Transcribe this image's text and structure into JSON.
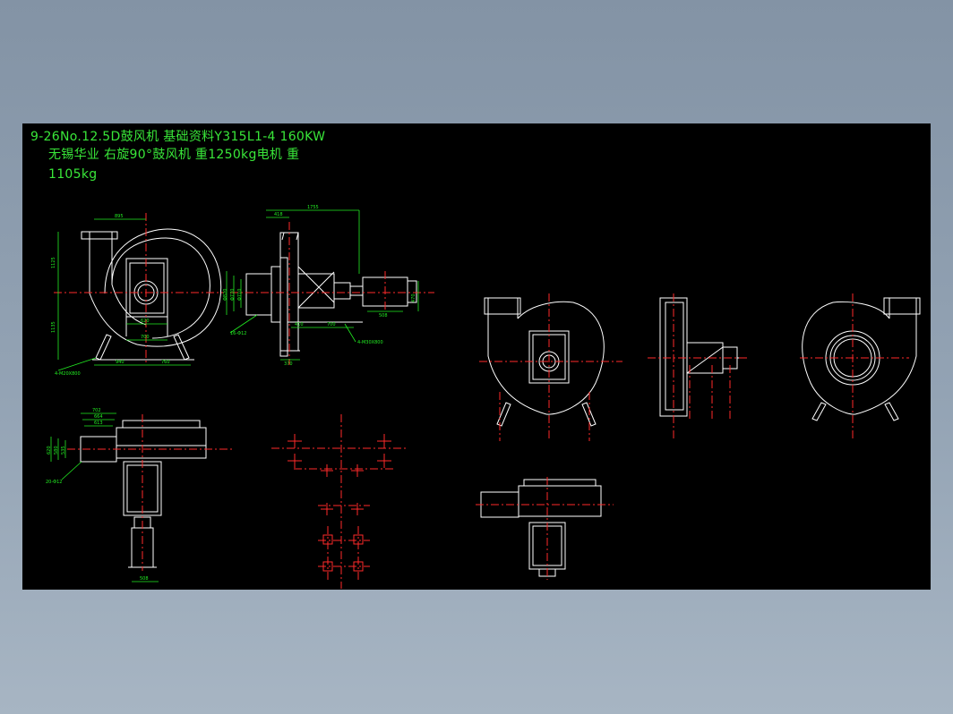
{
  "title": {
    "line1": "9-26No.12.5D鼓风机 基础资料Y315L1-4 160KW",
    "line2": "无锡华业 右旋90°鼓风机 重1250kg电机 重",
    "line3": "1105kg"
  },
  "dimensions": {
    "front_top": "895",
    "front_height_upper": "1125",
    "front_height_lower": "1135",
    "front_inner_width": "620",
    "front_base_inner": "700",
    "front_base_left": "940",
    "front_base_right": "760",
    "front_bolts": "4-M20X800",
    "side_top_small": "418",
    "side_top_total": "1755",
    "side_vert_1": "Φ820",
    "side_vert_2": "Φ770",
    "side_vert_3": "Φ710",
    "side_bottom_left": "410",
    "side_bottom_mid": "700",
    "side_motor": "508",
    "side_right": "470",
    "side_holes": "16-Φ12",
    "side_bolts": "4-M30X800",
    "side_base": "370",
    "plan_top_1": "702",
    "plan_top_2": "664",
    "plan_top_3": "613",
    "plan_left_1": "620",
    "plan_left_2": "580",
    "plan_left_3": "535",
    "plan_holes": "20-Φ12",
    "plan_motor": "508"
  },
  "colors": {
    "background": "#000000",
    "outline": "#ffffff",
    "centerline": "#ff2020",
    "dimension": "#22ff22",
    "title": "#39e639",
    "frame_bg": "#8a9aab"
  }
}
